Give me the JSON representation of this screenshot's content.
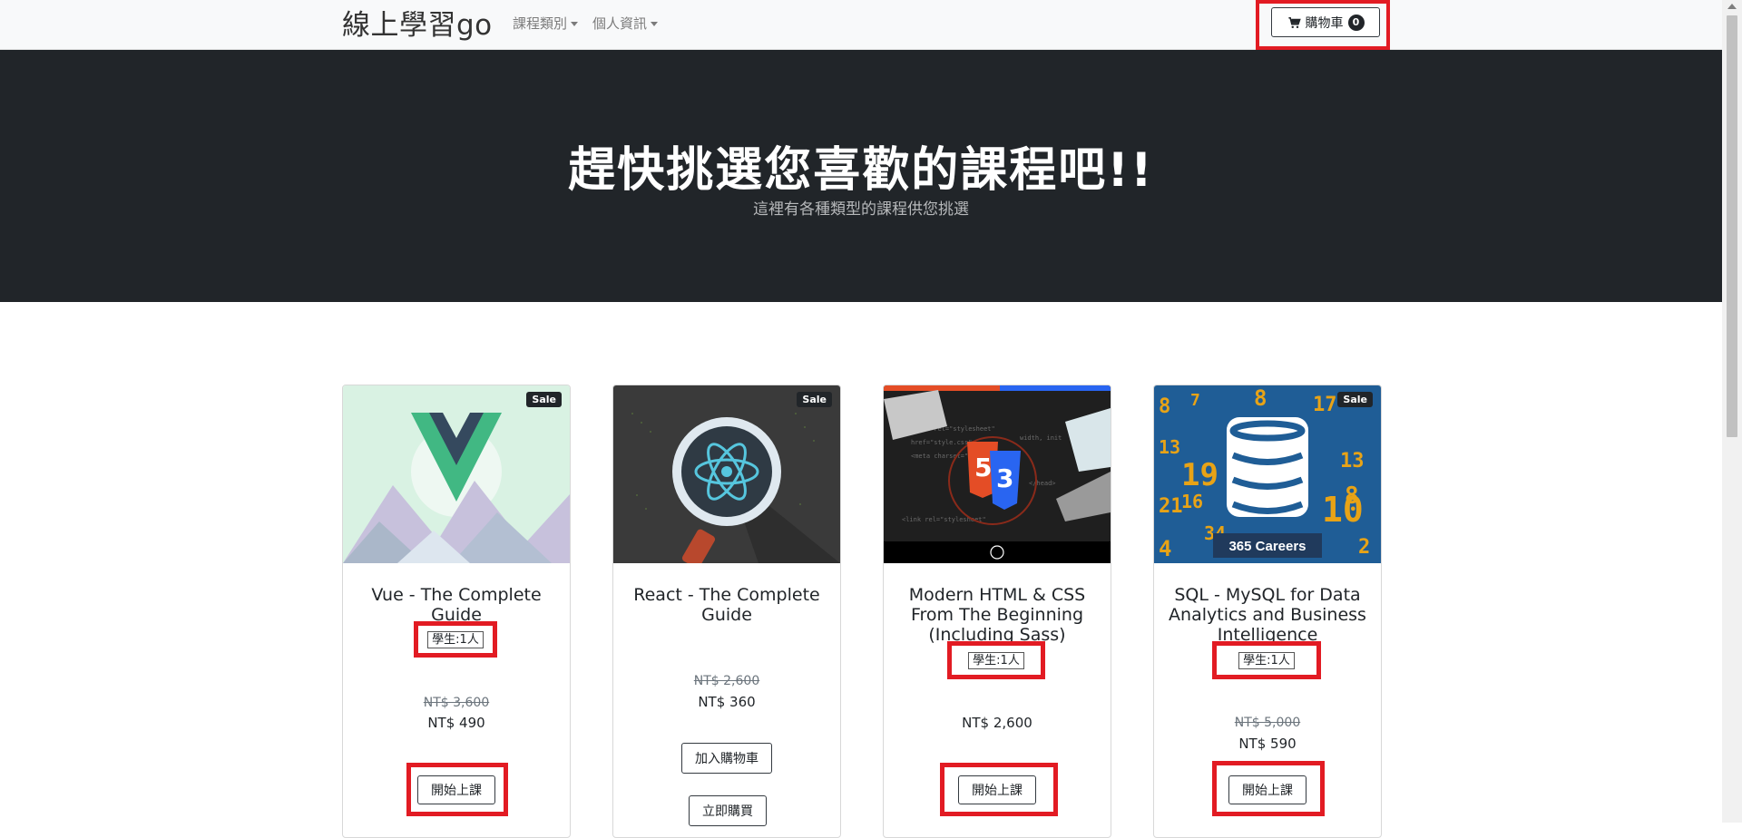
{
  "navbar": {
    "brand": "線上學習go",
    "menu": [
      {
        "label": "課程類別"
      },
      {
        "label": "個人資訊"
      }
    ],
    "cart": {
      "label": "購物車",
      "count": "0"
    }
  },
  "hero": {
    "title": "趕快挑選您喜歡的課程吧!!",
    "subtitle": "這裡有各種類型的課程供您挑選"
  },
  "courses": [
    {
      "title": "Vue - The Complete Guide",
      "sale_badge": "Sale",
      "students": "學生:1人",
      "price_original": "NT$ 3,600",
      "price": "NT$ 490",
      "buttons": [
        "開始上課"
      ]
    },
    {
      "title": "React - The Complete Guide",
      "sale_badge": "Sale",
      "students": "",
      "price_original": "NT$ 2,600",
      "price": "NT$ 360",
      "buttons": [
        "加入購物車",
        "立即購買"
      ]
    },
    {
      "title": "Modern HTML & CSS From The Beginning (Including Sass)",
      "sale_badge": "",
      "students": "學生:1人",
      "price_original": "",
      "price": "NT$ 2,600",
      "buttons": [
        "開始上課"
      ]
    },
    {
      "title": "SQL - MySQL for Data Analytics and Business Intelligence",
      "sale_badge": "Sale",
      "students": "學生:1人",
      "price_original": "NT$ 5,000",
      "price": "NT$ 590",
      "buttons": [
        "開始上課"
      ],
      "image_text": "365 Careers"
    }
  ],
  "colors": {
    "dark": "#212529",
    "highlight": "#e21b23",
    "navbar_bg": "#f8f9fa"
  }
}
